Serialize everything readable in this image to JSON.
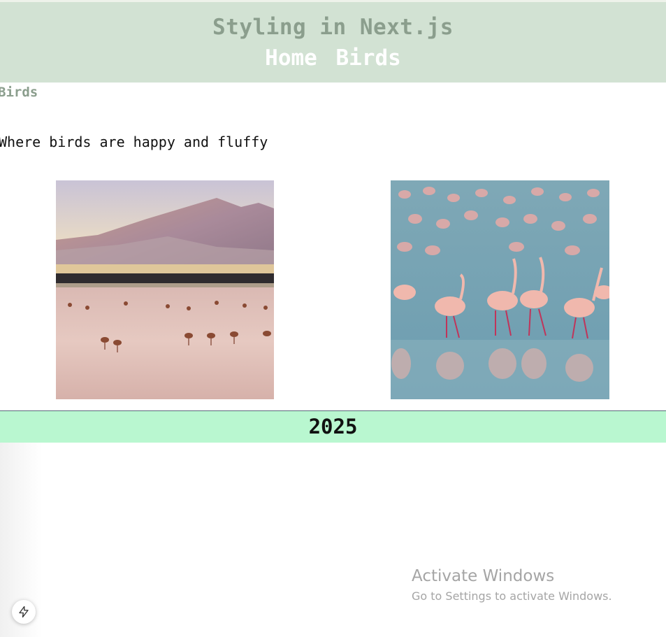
{
  "header": {
    "title": "Styling in Next.js",
    "nav": [
      {
        "label": "Home"
      },
      {
        "label": "Birds"
      }
    ]
  },
  "main": {
    "heading": "Birds",
    "tagline": "Where birds are happy and fluffy",
    "images": [
      {
        "description": "flamingos-at-lagoon-image"
      },
      {
        "description": "flamingo-flock-image"
      }
    ]
  },
  "footer": {
    "year": "2025"
  },
  "overlay": {
    "watermark_title": "Activate Windows",
    "watermark_subtitle": "Go to Settings to activate Windows.",
    "dev_indicator_icon": "lightning-bolt-icon"
  },
  "colors": {
    "header_bg": "#d2e2d3",
    "header_title": "#8b9e8d",
    "footer_bg": "#b9f7d0"
  }
}
